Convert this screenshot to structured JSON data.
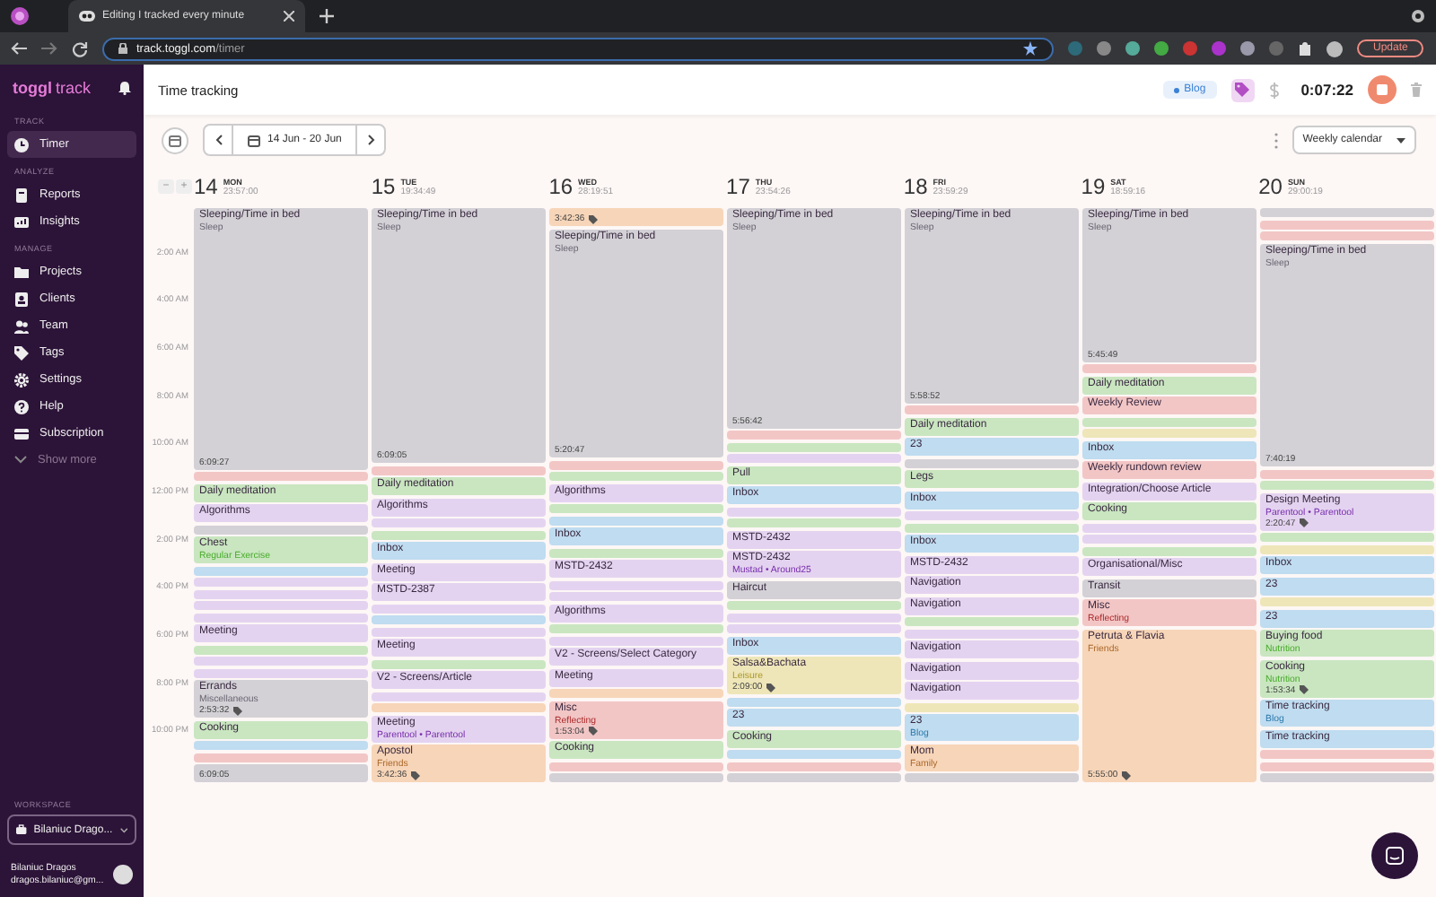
{
  "browser": {
    "tab_title": "Editing I tracked every minute",
    "url_host": "track.toggl.com",
    "url_path": "/timer",
    "update_label": "Update"
  },
  "sidebar": {
    "logo_bold": "toggl",
    "logo_light": "track",
    "sections": [
      {
        "heading": "TRACK",
        "items": [
          {
            "label": "Timer",
            "selected": true
          }
        ]
      },
      {
        "heading": "ANALYZE",
        "items": [
          {
            "label": "Reports",
            "selected": false
          },
          {
            "label": "Insights",
            "selected": false
          }
        ]
      },
      {
        "heading": "MANAGE",
        "items": [
          {
            "label": "Projects",
            "selected": false
          },
          {
            "label": "Clients",
            "selected": false
          },
          {
            "label": "Team",
            "selected": false
          },
          {
            "label": "Tags",
            "selected": false
          },
          {
            "label": "Settings",
            "selected": false
          },
          {
            "label": "Help",
            "selected": false
          },
          {
            "label": "Subscription",
            "selected": false
          }
        ]
      }
    ],
    "show_more": "Show more",
    "workspace_heading": "WORKSPACE",
    "workspace": "Bilaniuc Drago...",
    "user_name": "Bilaniuc Dragos",
    "user_email": "dragos.bilaniuc@gm..."
  },
  "header": {
    "title": "Time tracking",
    "project": {
      "label": "Blog",
      "color": "#3b82d6"
    },
    "timer": "0:07:22"
  },
  "toolbar": {
    "date_range": "14 Jun - 20 Jun",
    "view": "Weekly calendar"
  },
  "calendar": {
    "zoom_out": "−",
    "zoom_in": "+",
    "hours": [
      "2:00 AM",
      "4:00 AM",
      "6:00 AM",
      "8:00 AM",
      "10:00 AM",
      "12:00 PM",
      "2:00 PM",
      "4:00 PM",
      "6:00 PM",
      "8:00 PM",
      "10:00 PM"
    ],
    "days": [
      {
        "number": "14",
        "weekday": "MON",
        "total": "23:57:00",
        "entries": [
          {
            "kind": "long",
            "color": "#d3d1d6",
            "title": "Sleeping/Time in bed",
            "project": "Sleep",
            "duration": "6:09:27",
            "tag": false
          },
          {
            "kind": "stripe",
            "color": "#f3c6c6"
          },
          {
            "kind": "block",
            "color": "#c9e6c0",
            "title": "Daily meditation"
          },
          {
            "kind": "block",
            "color": "#e4d3f0",
            "title": "Algorithms"
          },
          {
            "kind": "stripe",
            "color": "#d3d1d6"
          },
          {
            "kind": "block",
            "color": "#c9e6c0",
            "title": "Chest",
            "project": "Regular Exercise"
          },
          {
            "kind": "stripe",
            "color": "#bfdcf0"
          },
          {
            "kind": "stripe",
            "color": "#e4d3f0"
          },
          {
            "kind": "stripe",
            "color": "#e4d3f0"
          },
          {
            "kind": "stripe",
            "color": "#e4d3f0"
          },
          {
            "kind": "stripe",
            "color": "#e4d3f0"
          },
          {
            "kind": "block",
            "color": "#e4d3f0",
            "title": "Meeting"
          },
          {
            "kind": "stripe",
            "color": "#c9e6c0"
          },
          {
            "kind": "stripe",
            "color": "#e4d3f0"
          },
          {
            "kind": "stripe",
            "color": "#e4d3f0"
          },
          {
            "kind": "block",
            "color": "#d3d1d6",
            "title": "Errands",
            "project": "Miscellaneous",
            "duration": "2:53:32",
            "tag": true
          },
          {
            "kind": "block",
            "color": "#c9e6c0",
            "title": "Cooking"
          },
          {
            "kind": "stripe",
            "color": "#bfdcf0"
          },
          {
            "kind": "stripe",
            "color": "#f3c6c6"
          },
          {
            "kind": "block",
            "color": "#d3d1d6",
            "duration": "6:09:05",
            "tag": false
          }
        ]
      },
      {
        "number": "15",
        "weekday": "TUE",
        "total": "19:34:49",
        "entries": [
          {
            "kind": "long",
            "color": "#d3d1d6",
            "title": "Sleeping/Time in bed",
            "project": "Sleep",
            "duration": "6:09:05",
            "tag": false
          },
          {
            "kind": "stripe",
            "color": "#f3c6c6"
          },
          {
            "kind": "block",
            "color": "#c9e6c0",
            "title": "Daily meditation"
          },
          {
            "kind": "block",
            "color": "#e4d3f0",
            "title": "Algorithms"
          },
          {
            "kind": "stripe",
            "color": "#e4d3f0"
          },
          {
            "kind": "stripe",
            "color": "#c9e6c0"
          },
          {
            "kind": "block",
            "color": "#bfdcf0",
            "title": "Inbox"
          },
          {
            "kind": "block",
            "color": "#e4d3f0",
            "title": "Meeting"
          },
          {
            "kind": "block",
            "color": "#e4d3f0",
            "title": "MSTD-2387"
          },
          {
            "kind": "stripe",
            "color": "#e4d3f0"
          },
          {
            "kind": "stripe",
            "color": "#bfdcf0"
          },
          {
            "kind": "stripe",
            "color": "#e4d3f0"
          },
          {
            "kind": "block",
            "color": "#e4d3f0",
            "title": "Meeting"
          },
          {
            "kind": "stripe",
            "color": "#c9e6c0"
          },
          {
            "kind": "block",
            "color": "#e4d3f0",
            "title": "V2 - Screens/Article"
          },
          {
            "kind": "stripe",
            "color": "#e4d3f0"
          },
          {
            "kind": "stripe",
            "color": "#f7d5b8"
          },
          {
            "kind": "block",
            "color": "#e4d3f0",
            "title": "Meeting",
            "project": "Parentool • Parentool"
          },
          {
            "kind": "block",
            "color": "#f7d5b8",
            "title": "Apostol",
            "project": "Friends",
            "duration": "3:42:36",
            "tag": true
          }
        ]
      },
      {
        "number": "16",
        "weekday": "WED",
        "total": "28:19:51",
        "entries": [
          {
            "kind": "block",
            "color": "#f7d5b8",
            "duration": "3:42:36",
            "tag": true
          },
          {
            "kind": "long",
            "color": "#d3d1d6",
            "title": "Sleeping/Time in bed",
            "project": "Sleep",
            "duration": "5:20:47",
            "tag": false
          },
          {
            "kind": "stripe",
            "color": "#f3c6c6"
          },
          {
            "kind": "stripe",
            "color": "#c9e6c0"
          },
          {
            "kind": "block",
            "color": "#e4d3f0",
            "title": "Algorithms"
          },
          {
            "kind": "stripe",
            "color": "#c9e6c0"
          },
          {
            "kind": "stripe",
            "color": "#bfdcf0"
          },
          {
            "kind": "block",
            "color": "#bfdcf0",
            "title": "Inbox"
          },
          {
            "kind": "stripe",
            "color": "#c9e6c0"
          },
          {
            "kind": "block",
            "color": "#e4d3f0",
            "title": "MSTD-2432"
          },
          {
            "kind": "stripe",
            "color": "#e4d3f0"
          },
          {
            "kind": "stripe",
            "color": "#e4d3f0"
          },
          {
            "kind": "block",
            "color": "#e4d3f0",
            "title": "Algorithms"
          },
          {
            "kind": "stripe",
            "color": "#c9e6c0"
          },
          {
            "kind": "stripe",
            "color": "#e4d3f0"
          },
          {
            "kind": "block",
            "color": "#e4d3f0",
            "title": "V2 - Screens/Select Category"
          },
          {
            "kind": "block",
            "color": "#e4d3f0",
            "title": "Meeting"
          },
          {
            "kind": "stripe",
            "color": "#f7d5b8"
          },
          {
            "kind": "block",
            "color": "#f3c6c6",
            "title": "Misc",
            "project": "Reflecting",
            "duration": "1:53:04",
            "tag": true
          },
          {
            "kind": "block",
            "color": "#c9e6c0",
            "title": "Cooking"
          },
          {
            "kind": "stripe",
            "color": "#f3c6c6"
          },
          {
            "kind": "stripe",
            "color": "#d3d1d6"
          }
        ]
      },
      {
        "number": "17",
        "weekday": "THU",
        "total": "23:54:26",
        "entries": [
          {
            "kind": "long",
            "color": "#d3d1d6",
            "title": "Sleeping/Time in bed",
            "project": "Sleep",
            "duration": "5:56:42",
            "tag": false
          },
          {
            "kind": "stripe",
            "color": "#f3c6c6"
          },
          {
            "kind": "stripe",
            "color": "#c9e6c0"
          },
          {
            "kind": "stripe",
            "color": "#e4d3f0"
          },
          {
            "kind": "block",
            "color": "#c9e6c0",
            "title": "Pull"
          },
          {
            "kind": "block",
            "color": "#bfdcf0",
            "title": "Inbox"
          },
          {
            "kind": "stripe",
            "color": "#e4d3f0"
          },
          {
            "kind": "stripe",
            "color": "#c9e6c0"
          },
          {
            "kind": "block",
            "color": "#e4d3f0",
            "title": "MSTD-2432"
          },
          {
            "kind": "block",
            "color": "#e4d3f0",
            "title": "MSTD-2432",
            "project": "Mustad • Around25"
          },
          {
            "kind": "block",
            "color": "#d3d1d6",
            "title": "Haircut"
          },
          {
            "kind": "stripe",
            "color": "#c9e6c0"
          },
          {
            "kind": "stripe",
            "color": "#e4d3f0"
          },
          {
            "kind": "stripe",
            "color": "#e4d3f0"
          },
          {
            "kind": "block",
            "color": "#bfdcf0",
            "title": "Inbox"
          },
          {
            "kind": "block",
            "color": "#eee6b8",
            "title": "Salsa&Bachata",
            "project": "Leisure",
            "duration": "2:09:00",
            "tag": true
          },
          {
            "kind": "stripe",
            "color": "#bfdcf0"
          },
          {
            "kind": "block",
            "color": "#bfdcf0",
            "title": "23"
          },
          {
            "kind": "block",
            "color": "#c9e6c0",
            "title": "Cooking"
          },
          {
            "kind": "stripe",
            "color": "#bfdcf0"
          },
          {
            "kind": "stripe",
            "color": "#f3c6c6"
          },
          {
            "kind": "stripe",
            "color": "#d3d1d6"
          }
        ]
      },
      {
        "number": "18",
        "weekday": "FRI",
        "total": "23:59:29",
        "entries": [
          {
            "kind": "long",
            "color": "#d3d1d6",
            "title": "Sleeping/Time in bed",
            "project": "Sleep",
            "duration": "5:58:52",
            "tag": false
          },
          {
            "kind": "stripe",
            "color": "#f3c6c6"
          },
          {
            "kind": "block",
            "color": "#c9e6c0",
            "title": "Daily meditation"
          },
          {
            "kind": "block",
            "color": "#bfdcf0",
            "title": "23"
          },
          {
            "kind": "stripe",
            "color": "#d3d1d6"
          },
          {
            "kind": "block",
            "color": "#c9e6c0",
            "title": "Legs"
          },
          {
            "kind": "block",
            "color": "#bfdcf0",
            "title": "Inbox"
          },
          {
            "kind": "stripe",
            "color": "#e4d3f0"
          },
          {
            "kind": "stripe",
            "color": "#c9e6c0"
          },
          {
            "kind": "block",
            "color": "#bfdcf0",
            "title": "Inbox"
          },
          {
            "kind": "block",
            "color": "#e4d3f0",
            "title": "MSTD-2432"
          },
          {
            "kind": "block",
            "color": "#e4d3f0",
            "title": "Navigation"
          },
          {
            "kind": "block",
            "color": "#e4d3f0",
            "title": "Navigation"
          },
          {
            "kind": "stripe",
            "color": "#c9e6c0"
          },
          {
            "kind": "stripe",
            "color": "#e4d3f0"
          },
          {
            "kind": "block",
            "color": "#e4d3f0",
            "title": "Navigation"
          },
          {
            "kind": "block",
            "color": "#e4d3f0",
            "title": "Navigation"
          },
          {
            "kind": "block",
            "color": "#e4d3f0",
            "title": "Navigation"
          },
          {
            "kind": "stripe",
            "color": "#eee6b8"
          },
          {
            "kind": "block",
            "color": "#bfdcf0",
            "title": "23",
            "project": "Blog"
          },
          {
            "kind": "block",
            "color": "#f7d5b8",
            "title": "Mom",
            "project": "Family"
          },
          {
            "kind": "stripe",
            "color": "#d3d1d6"
          }
        ]
      },
      {
        "number": "19",
        "weekday": "SAT",
        "total": "18:59:16",
        "entries": [
          {
            "kind": "long",
            "color": "#d3d1d6",
            "title": "Sleeping/Time in bed",
            "project": "Sleep",
            "duration": "5:45:49",
            "tag": false
          },
          {
            "kind": "stripe",
            "color": "#f3c6c6"
          },
          {
            "kind": "block",
            "color": "#c9e6c0",
            "title": "Daily meditation"
          },
          {
            "kind": "block",
            "color": "#f3c6c6",
            "title": "Weekly Review"
          },
          {
            "kind": "stripe",
            "color": "#c9e6c0"
          },
          {
            "kind": "stripe",
            "color": "#eee6b8"
          },
          {
            "kind": "block",
            "color": "#bfdcf0",
            "title": "Inbox"
          },
          {
            "kind": "block",
            "color": "#f3c6c6",
            "title": "Weekly rundown review"
          },
          {
            "kind": "block",
            "color": "#e4d3f0",
            "title": "Integration/Choose Article"
          },
          {
            "kind": "block",
            "color": "#c9e6c0",
            "title": "Cooking"
          },
          {
            "kind": "stripe",
            "color": "#e4d3f0"
          },
          {
            "kind": "stripe",
            "color": "#e4d3f0"
          },
          {
            "kind": "stripe",
            "color": "#c9e6c0"
          },
          {
            "kind": "block",
            "color": "#e4d3f0",
            "title": "Organisational/Misc"
          },
          {
            "kind": "block",
            "color": "#d3d1d6",
            "title": "Transit"
          },
          {
            "kind": "block",
            "color": "#f3c6c6",
            "title": "Misc",
            "project": "Reflecting"
          },
          {
            "kind": "long",
            "color": "#f7d5b8",
            "title": "Petruta & Flavia",
            "project": "Friends",
            "duration": "5:55:00",
            "tag": true
          }
        ]
      },
      {
        "number": "20",
        "weekday": "SUN",
        "total": "29:00:19",
        "entries": [
          {
            "kind": "stripe",
            "color": "#d3d1d6"
          },
          {
            "kind": "stripe",
            "color": "#f3c6c6"
          },
          {
            "kind": "stripe",
            "color": "#f3c6c6"
          },
          {
            "kind": "long",
            "color": "#d3d1d6",
            "title": "Sleeping/Time in bed",
            "project": "Sleep",
            "duration": "7:40:19",
            "tag": false
          },
          {
            "kind": "stripe",
            "color": "#f3c6c6"
          },
          {
            "kind": "stripe",
            "color": "#c9e6c0"
          },
          {
            "kind": "block",
            "color": "#e4d3f0",
            "title": "Design Meeting",
            "project": "Parentool • Parentool",
            "duration": "2:20:47",
            "tag": true
          },
          {
            "kind": "stripe",
            "color": "#c9e6c0"
          },
          {
            "kind": "stripe",
            "color": "#eee6b8"
          },
          {
            "kind": "block",
            "color": "#bfdcf0",
            "title": "Inbox"
          },
          {
            "kind": "block",
            "color": "#bfdcf0",
            "title": "23"
          },
          {
            "kind": "stripe",
            "color": "#eee6b8"
          },
          {
            "kind": "block",
            "color": "#bfdcf0",
            "title": "23"
          },
          {
            "kind": "block",
            "color": "#c9e6c0",
            "title": "Buying food",
            "project": "Nutrition"
          },
          {
            "kind": "block",
            "color": "#c9e6c0",
            "title": "Cooking",
            "project": "Nutrition",
            "duration": "1:53:34",
            "tag": true
          },
          {
            "kind": "block",
            "color": "#bfdcf0",
            "title": "Time tracking",
            "project": "Blog"
          },
          {
            "kind": "block",
            "color": "#bfdcf0",
            "title": "Time tracking"
          },
          {
            "kind": "stripe",
            "color": "#f3c6c6"
          },
          {
            "kind": "stripe",
            "color": "#f3c6c6"
          },
          {
            "kind": "stripe",
            "color": "#d3d1d6"
          }
        ]
      }
    ]
  }
}
